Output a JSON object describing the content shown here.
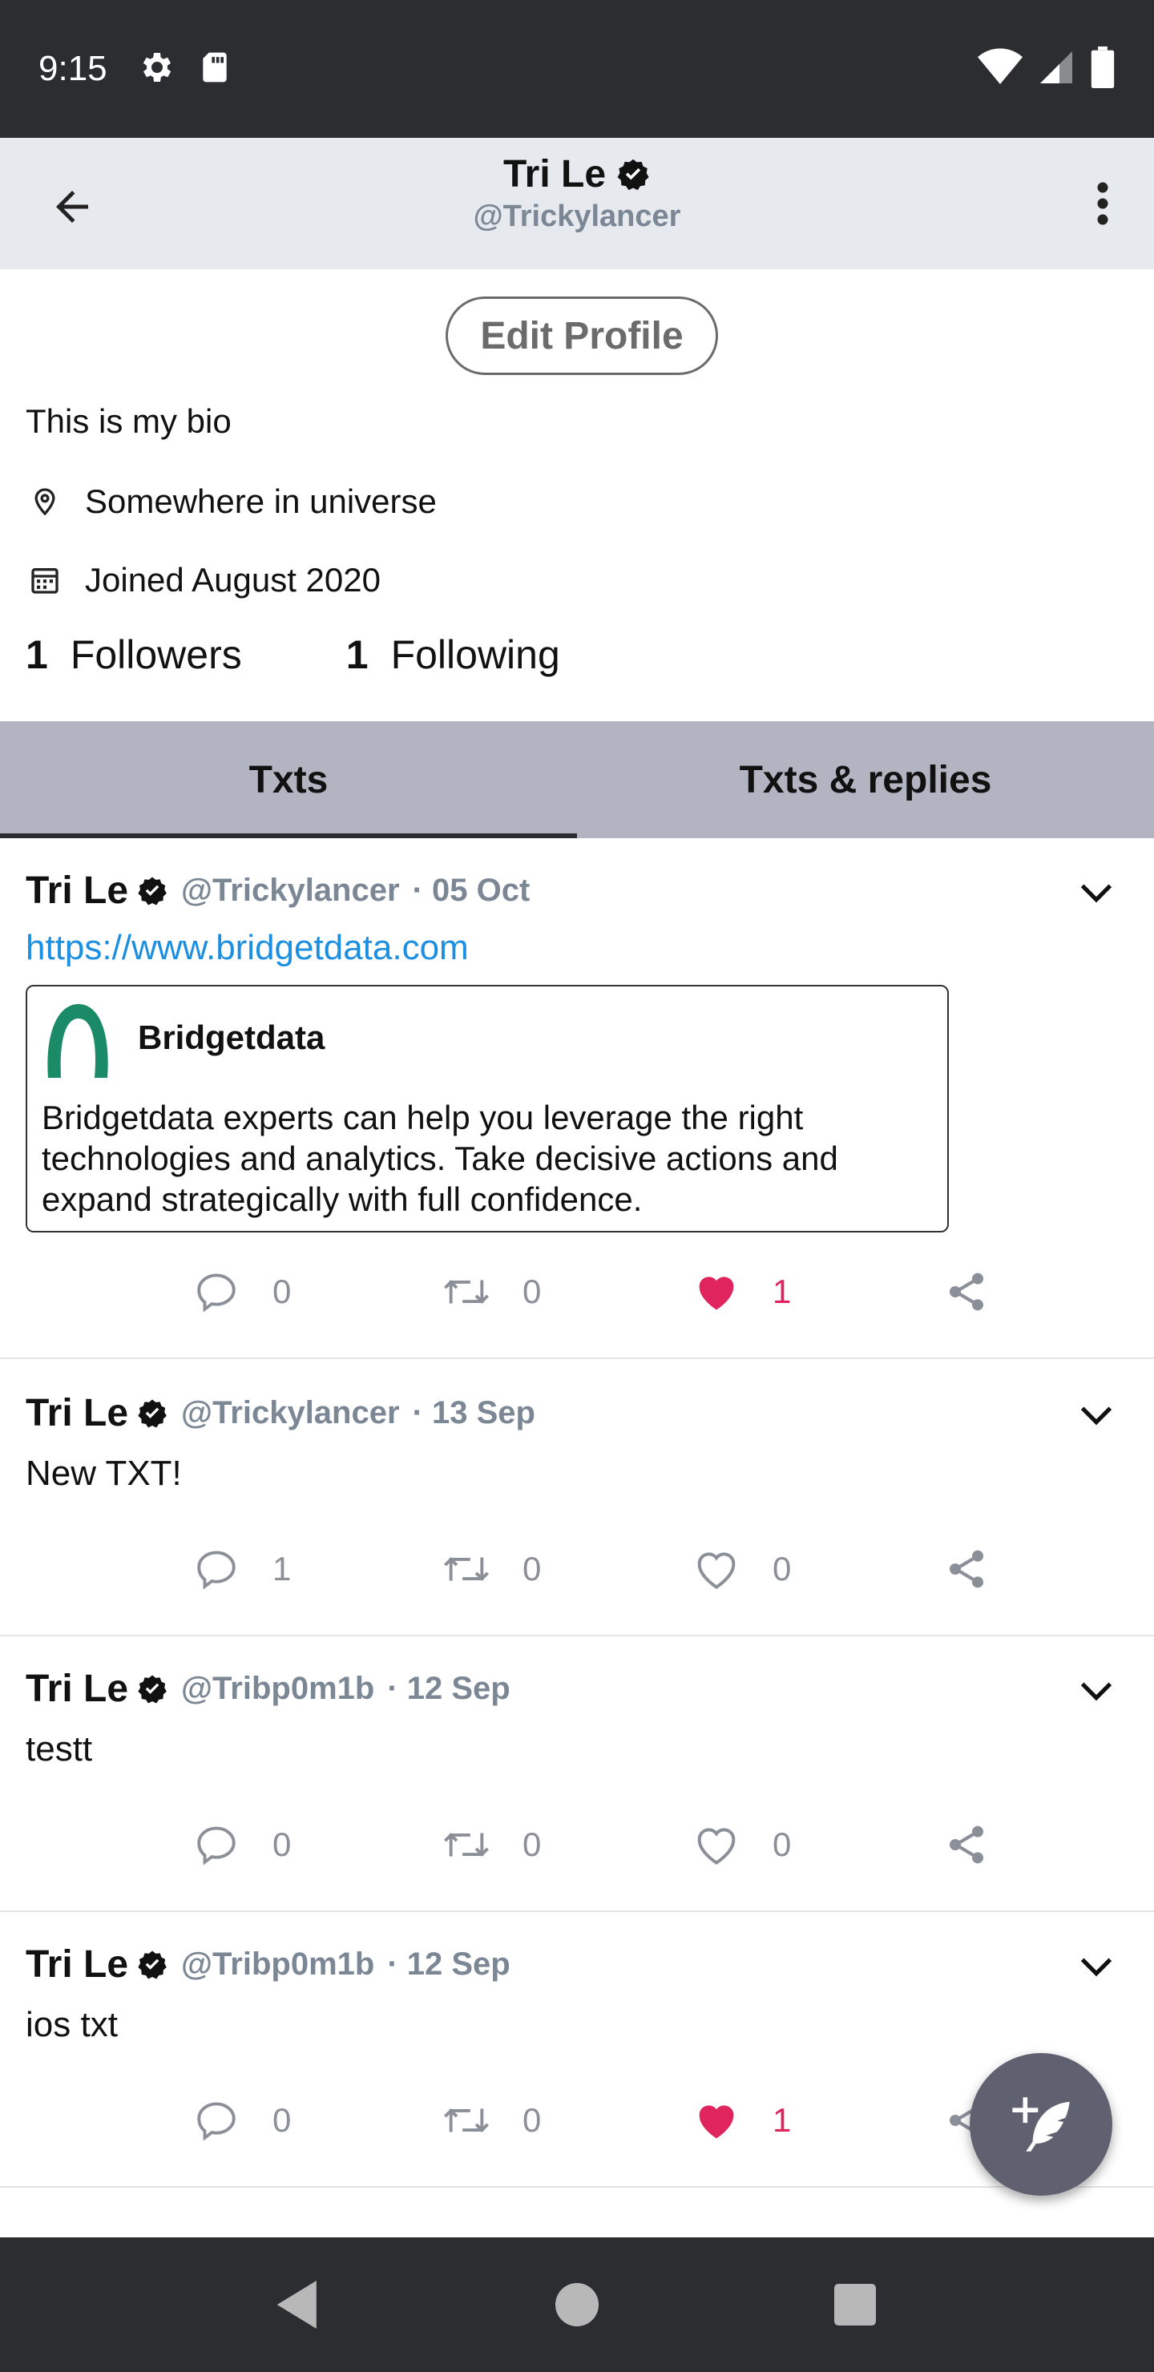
{
  "status_bar": {
    "time": "9:15"
  },
  "app_bar": {
    "title": "Tri Le",
    "handle": "@Trickylancer"
  },
  "profile": {
    "edit_label": "Edit Profile",
    "bio": "This is my bio",
    "location": "Somewhere in universe",
    "joined": "Joined August 2020",
    "followers_count": "1",
    "followers_label": "Followers",
    "following_count": "1",
    "following_label": "Following"
  },
  "tabs": [
    {
      "label": "Txts",
      "active": true
    },
    {
      "label": "Txts & replies",
      "active": false
    }
  ],
  "posts": [
    {
      "name": "Tri Le",
      "handle": "@Trickylancer",
      "date": "· 05 Oct",
      "link": "https://www.bridgetdata.com",
      "card": {
        "title": "Bridgetdata",
        "description": "Bridgetdata experts can help you leverage the right technologies and analytics. Take decisive actions and expand strategically with full confidence."
      },
      "replies": "0",
      "retxts": "0",
      "likes": "1",
      "liked": true
    },
    {
      "name": "Tri Le",
      "handle": "@Trickylancer",
      "date": "· 13 Sep",
      "text": "New TXT!",
      "replies": "1",
      "retxts": "0",
      "likes": "0",
      "liked": false
    },
    {
      "name": "Tri Le",
      "handle": "@Tribp0m1b",
      "date": "· 12 Sep",
      "text": "testt",
      "replies": "0",
      "retxts": "0",
      "likes": "0",
      "liked": false
    },
    {
      "name": "Tri Le",
      "handle": "@Tribp0m1b",
      "date": "· 12 Sep",
      "text": "ios txt",
      "replies": "0",
      "retxts": "0",
      "likes": "1",
      "liked": true
    }
  ],
  "colors": {
    "link": "#1d8fe1",
    "like": "#e0245e",
    "tab_bar": "#b3b4c1",
    "app_bar": "#e6e9ee",
    "system_bar": "#2b2d31",
    "brand_logo": "#1a8a67"
  },
  "icons": {
    "status": [
      "gear-icon",
      "sd-card-icon",
      "wifi-icon",
      "cell-signal-icon",
      "battery-icon"
    ],
    "app_bar": [
      "back-arrow-icon",
      "more-vert-icon"
    ],
    "profile": [
      "location-pin-icon",
      "calendar-icon",
      "verified-badge-icon"
    ],
    "actions": [
      "reply-icon",
      "retxt-icon",
      "heart-icon",
      "share-icon"
    ],
    "fab": "compose-feather-icon",
    "nav": [
      "nav-back-icon",
      "nav-home-icon",
      "nav-recents-icon"
    ]
  }
}
